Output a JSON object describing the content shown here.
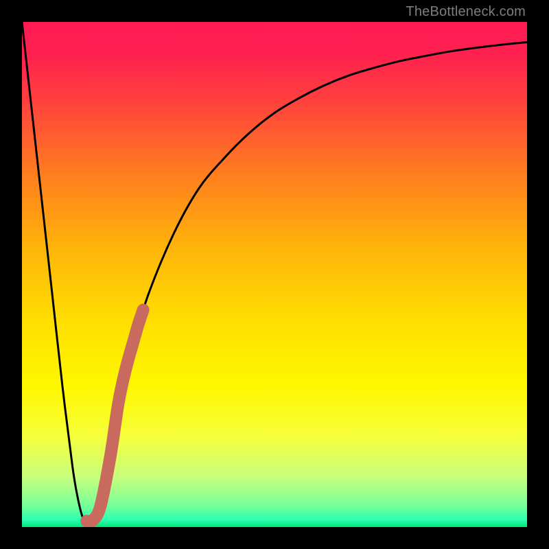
{
  "attribution": "TheBottleneck.com",
  "colors": {
    "frame": "#000000",
    "gradient_stops": [
      {
        "offset": 0.0,
        "color": "#ff1a52"
      },
      {
        "offset": 0.06,
        "color": "#ff2050"
      },
      {
        "offset": 0.15,
        "color": "#ff3e3e"
      },
      {
        "offset": 0.3,
        "color": "#ff7d1f"
      },
      {
        "offset": 0.45,
        "color": "#ffb50a"
      },
      {
        "offset": 0.6,
        "color": "#ffe000"
      },
      {
        "offset": 0.72,
        "color": "#fff700"
      },
      {
        "offset": 0.82,
        "color": "#f6ff3a"
      },
      {
        "offset": 0.9,
        "color": "#c8ff7c"
      },
      {
        "offset": 0.955,
        "color": "#7cff97"
      },
      {
        "offset": 0.985,
        "color": "#2dffb0"
      },
      {
        "offset": 1.0,
        "color": "#00e57a"
      }
    ],
    "curve": "#000000",
    "accent_stroke": "#c96a5f"
  },
  "chart_data": {
    "type": "line",
    "title": "",
    "xlabel": "",
    "ylabel": "",
    "xlim": [
      0,
      100
    ],
    "ylim": [
      0,
      100
    ],
    "grid": false,
    "series": [
      {
        "name": "bottleneck-curve",
        "x": [
          0,
          2,
          4,
          6,
          8,
          10,
          11,
          12,
          13,
          14,
          16,
          18,
          20,
          22,
          25,
          30,
          35,
          40,
          45,
          50,
          55,
          60,
          65,
          70,
          75,
          80,
          85,
          90,
          95,
          100
        ],
        "values": [
          100,
          82,
          64,
          46,
          28,
          12,
          6,
          2,
          1,
          2,
          8,
          18,
          28,
          36,
          46,
          58,
          67,
          73,
          78,
          82,
          85,
          87.5,
          89.5,
          91,
          92.3,
          93.3,
          94.2,
          94.9,
          95.5,
          96
        ]
      }
    ],
    "accent_segment": {
      "name": "highlight",
      "x": [
        12.8,
        13.2,
        14.0,
        15.5,
        17.5,
        19.0,
        20.0,
        21.0,
        22.0,
        23.0,
        24.0
      ],
      "values": [
        1.2,
        1.0,
        1.3,
        4.0,
        14.0,
        24.0,
        29.0,
        33.0,
        36.5,
        40.0,
        43.0
      ]
    }
  }
}
